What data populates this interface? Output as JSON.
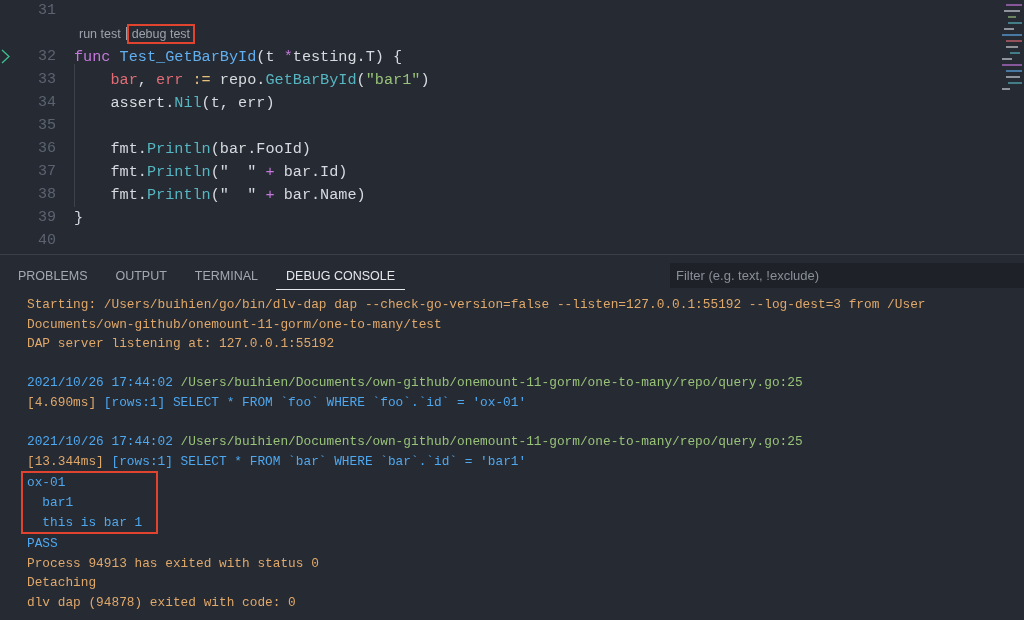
{
  "editor": {
    "lines": [
      {
        "number": "31",
        "marker": false
      },
      {
        "number": "32",
        "marker": true,
        "codelens": [
          {
            "label": "run test",
            "highlighted": false
          },
          {
            "label": "debug test",
            "highlighted": true
          }
        ],
        "tokens": [
          {
            "text": "func ",
            "kind": "keyword"
          },
          {
            "text": "Test_GetBarById",
            "kind": "function"
          },
          {
            "text": "(t ",
            "kind": "plain"
          },
          {
            "text": "*",
            "kind": "operator"
          },
          {
            "text": "testing.T) {",
            "kind": "plain"
          }
        ]
      },
      {
        "number": "33",
        "marker": false,
        "tokens": [
          {
            "text": "    bar",
            "kind": "variable"
          },
          {
            "text": ", ",
            "kind": "plain"
          },
          {
            "text": "err",
            "kind": "variable"
          },
          {
            "text": " := ",
            "kind": "assign"
          },
          {
            "text": "repo.",
            "kind": "plain"
          },
          {
            "text": "GetBarById",
            "kind": "method"
          },
          {
            "text": "(",
            "kind": "plain"
          },
          {
            "text": "\"bar1\"",
            "kind": "string"
          },
          {
            "text": ")",
            "kind": "plain"
          }
        ]
      },
      {
        "number": "34",
        "marker": false,
        "tokens": [
          {
            "text": "    assert.",
            "kind": "plain"
          },
          {
            "text": "Nil",
            "kind": "method"
          },
          {
            "text": "(t, err)",
            "kind": "plain"
          }
        ]
      },
      {
        "number": "35",
        "marker": false
      },
      {
        "number": "36",
        "marker": false,
        "tokens": [
          {
            "text": "    fmt.",
            "kind": "plain"
          },
          {
            "text": "Println",
            "kind": "method"
          },
          {
            "text": "(bar.FooId)",
            "kind": "plain"
          }
        ]
      },
      {
        "number": "37",
        "marker": false,
        "tokens": [
          {
            "text": "    fmt.",
            "kind": "plain"
          },
          {
            "text": "Println",
            "kind": "method"
          },
          {
            "text": "(\"  \" ",
            "kind": "plain"
          },
          {
            "text": "+",
            "kind": "operator"
          },
          {
            "text": " bar.Id)",
            "kind": "plain"
          }
        ]
      },
      {
        "number": "38",
        "marker": false,
        "tokens": [
          {
            "text": "    fmt.",
            "kind": "plain"
          },
          {
            "text": "Println",
            "kind": "method"
          },
          {
            "text": "(\"  \" ",
            "kind": "plain"
          },
          {
            "text": "+",
            "kind": "operator"
          },
          {
            "text": " bar.Name)",
            "kind": "plain"
          }
        ]
      },
      {
        "number": "39",
        "marker": false,
        "tokens": [
          {
            "text": "}",
            "kind": "plain"
          }
        ]
      },
      {
        "number": "40",
        "marker": false
      }
    ]
  },
  "panel": {
    "tabs": [
      {
        "label": "PROBLEMS",
        "selected": false
      },
      {
        "label": "OUTPUT",
        "selected": false
      },
      {
        "label": "TERMINAL",
        "selected": false
      },
      {
        "label": "DEBUG CONSOLE",
        "selected": true
      }
    ],
    "filter": {
      "placeholder": "Filter (e.g. text, !exclude)"
    },
    "console": [
      {
        "kind": "text",
        "highlighted": false,
        "tokens": [
          {
            "text": "Starting: /Users/buihien/go/bin/dlv-dap dap --check-go-version=false --listen=127.0.0.1:55192 --log-dest=3 from /User",
            "kind": "info"
          }
        ]
      },
      {
        "kind": "text",
        "highlighted": false,
        "tokens": [
          {
            "text": "Documents/own-github/onemount-11-gorm/one-to-many/test",
            "kind": "info"
          }
        ]
      },
      {
        "kind": "text",
        "highlighted": false,
        "tokens": [
          {
            "text": "DAP server listening at: 127.0.0.1:55192",
            "kind": "info"
          }
        ]
      },
      {
        "kind": "blank",
        "highlighted": false
      },
      {
        "kind": "text",
        "highlighted": false,
        "tokens": [
          {
            "text": "2021/10/26 17:44:02 ",
            "kind": "log"
          },
          {
            "text": "/Users/buihien/Documents/own-github/onemount-11-gorm/one-to-many/repo/query.go:25",
            "kind": "path"
          }
        ]
      },
      {
        "kind": "text",
        "highlighted": false,
        "tokens": [
          {
            "text": "[4.690ms] ",
            "kind": "info"
          },
          {
            "text": "[rows:1] SELECT * FROM `foo` WHERE `foo`.`id` = 'ox-01'",
            "kind": "log"
          }
        ]
      },
      {
        "kind": "blank",
        "highlighted": false
      },
      {
        "kind": "text",
        "highlighted": false,
        "tokens": [
          {
            "text": "2021/10/26 17:44:02 ",
            "kind": "log"
          },
          {
            "text": "/Users/buihien/Documents/own-github/onemount-11-gorm/one-to-many/repo/query.go:25",
            "kind": "path"
          }
        ]
      },
      {
        "kind": "text",
        "highlighted": false,
        "tokens": [
          {
            "text": "[13.344ms] ",
            "kind": "info"
          },
          {
            "text": "[rows:1] SELECT * FROM `bar` WHERE `bar`.`id` = 'bar1'",
            "kind": "log"
          }
        ]
      },
      {
        "kind": "text",
        "highlighted": true,
        "tokens": [
          {
            "text": "ox-01",
            "kind": "log"
          }
        ]
      },
      {
        "kind": "text",
        "highlighted": true,
        "tokens": [
          {
            "text": "  bar1",
            "kind": "log"
          }
        ]
      },
      {
        "kind": "text",
        "highlighted": true,
        "tokens": [
          {
            "text": "  this is bar 1",
            "kind": "log"
          }
        ]
      },
      {
        "kind": "text",
        "highlighted": false,
        "tokens": [
          {
            "text": "PASS",
            "kind": "log"
          }
        ]
      },
      {
        "kind": "text",
        "highlighted": false,
        "tokens": [
          {
            "text": "Process 94913 has exited with status 0",
            "kind": "info"
          }
        ]
      },
      {
        "kind": "text",
        "highlighted": false,
        "tokens": [
          {
            "text": "Detaching",
            "kind": "info"
          }
        ]
      },
      {
        "kind": "text",
        "highlighted": false,
        "tokens": [
          {
            "text": "dlv dap (94878) exited with code: 0",
            "kind": "info"
          }
        ]
      }
    ]
  }
}
